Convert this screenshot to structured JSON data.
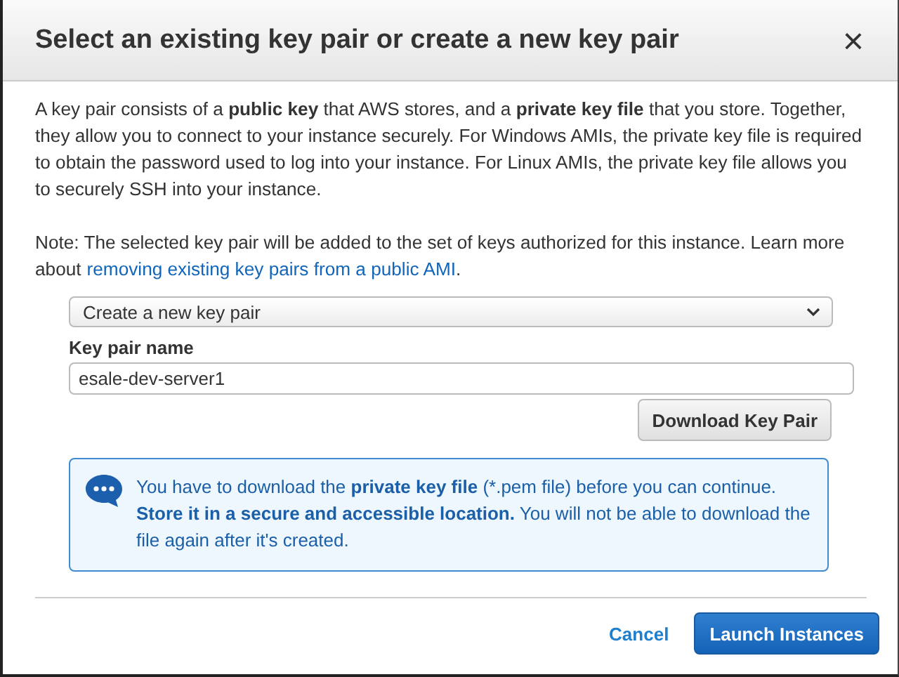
{
  "dialog": {
    "title": "Select an existing key pair or create a new key pair",
    "close": "×"
  },
  "intro": "A key pair consists of a **public key** that AWS stores, and a **private key file** that you store. Together, they allow you to connect to your instance securely. For Windows AMIs, the private key file is required to obtain the password used to log into your instance. For Linux AMIs, the private key file allows you to securely SSH into your instance.",
  "note": {
    "text": "Note: The selected key pair will be added to the set of keys authorized for this instance. Learn more about",
    "link": "removing existing key pairs from a public AMI",
    "end": "."
  },
  "key_pair_select": {
    "value": "Create a new key pair"
  },
  "key_pair_name": {
    "label": "Key pair name",
    "value": "esale-dev-server1"
  },
  "download_button": "Download Key Pair",
  "info": "You have to download the **private key file** (*.pem file) before you can continue. **Store it in a secure and accessible location.** You will not be able to download the file again after it's created.",
  "footer": {
    "cancel": "Cancel",
    "launch": "Launch Instances"
  }
}
